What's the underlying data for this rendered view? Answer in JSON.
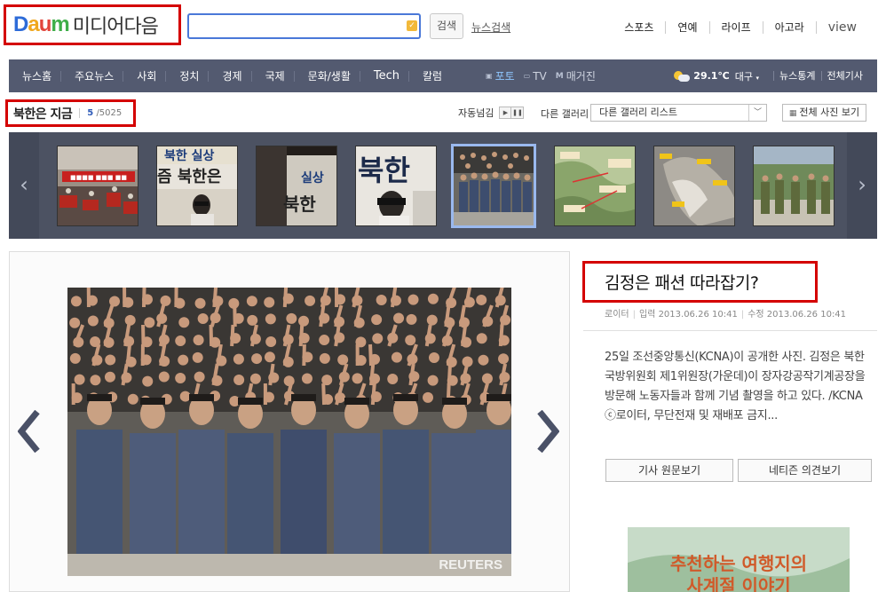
{
  "header": {
    "logo_daum": "Daum",
    "logo_media": "미디어다음",
    "search_placeholder": "",
    "search_button": "검색",
    "news_search_link": "뉴스검색",
    "top_nav": [
      "스포츠",
      "연예",
      "라이프",
      "아고라",
      "view"
    ]
  },
  "gnb": {
    "items": [
      "뉴스홈",
      "주요뉴스",
      "사회",
      "정치",
      "경제",
      "국제",
      "문화/생활",
      "Tech",
      "칼럼"
    ],
    "media": [
      {
        "icon": "camera-icon",
        "label": "포토",
        "active": true
      },
      {
        "icon": "tv-icon",
        "label": "TV",
        "active": false
      },
      {
        "icon": "magazine-icon",
        "label": "매거진",
        "active": false
      }
    ],
    "weather": {
      "icon": "partly-cloudy-icon",
      "temp": "29.1℃",
      "city": "대구"
    },
    "right_links": [
      "뉴스통계",
      "전체기사"
    ]
  },
  "gallery": {
    "title": "북한은 지금",
    "current": "5",
    "total": "/5025",
    "autoplay_label": "자동넘김",
    "other_gallery_label": "다른 갤러리",
    "select_value": "다른 갤러리 리스트",
    "all_photos_button": "전체 사진 보기",
    "selected_index": 4,
    "thumbnails": [
      {
        "name": "thumb-rally-crowd",
        "kind": "rally"
      },
      {
        "name": "thumb-broadcast-sign-1",
        "kind": "sign"
      },
      {
        "name": "thumb-sign-closeup",
        "kind": "signclose"
      },
      {
        "name": "thumb-broadcast-sign-2",
        "kind": "sign2"
      },
      {
        "name": "thumb-group-photo",
        "kind": "group"
      },
      {
        "name": "thumb-map-1",
        "kind": "map"
      },
      {
        "name": "thumb-satellite",
        "kind": "satellite"
      },
      {
        "name": "thumb-soldiers",
        "kind": "soldiers"
      }
    ],
    "thumb_texts": {
      "t2_line1": "북한 실상",
      "t2_line2": "즘 북한은",
      "t4_big": "북한",
      "t3_big": "실상",
      "t3_small": "북한"
    }
  },
  "photo": {
    "watermark": "REUTERS"
  },
  "article": {
    "title": "김정은 패션 따라잡기?",
    "source": "로이터",
    "input_label": "입력 2013.06.26 10:41",
    "edit_label": "수정 2013.06.26 10:41",
    "body": "25일 조선중앙통신(KCNA)이 공개한 사진. 김정은 북한 국방위원회 제1위원장(가운데)이 장자강공작기계공장을 방문해 노동자들과 함께 기념 촬영을 하고 있다. /KCNA ⓒ로이터, 무단전재 및 재배포 금지...",
    "btn_original": "기사 원문보기",
    "btn_comments": "네티즌 의견보기",
    "ad_line1": "추천하는 여행지의",
    "ad_line2": "사계절 이야기"
  },
  "colors": {
    "gnb_bg": "#535a70",
    "strip_bg": "#4c5262",
    "highlight_red": "#d40000",
    "accent_blue": "#4a78d8"
  }
}
